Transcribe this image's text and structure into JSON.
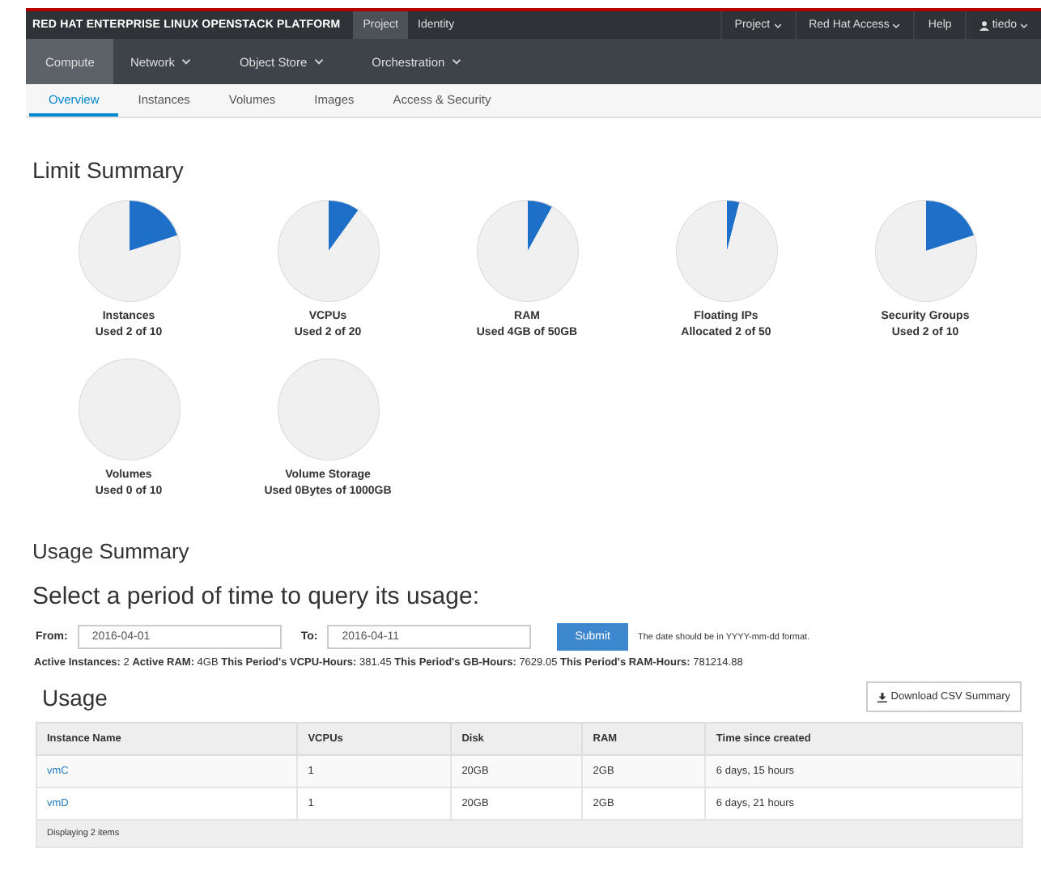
{
  "topbar": {
    "brand": "RED HAT",
    "product": "ENTERPRISE LINUX OPENSTACK PLATFORM",
    "tabs": [
      {
        "label": "Project",
        "selected": true
      },
      {
        "label": "Identity",
        "selected": false
      }
    ],
    "menus": [
      "Project",
      "Red Hat Access"
    ],
    "help": "Help",
    "user": "tiedo"
  },
  "nav": [
    {
      "label": "Compute",
      "selected": true,
      "dropdown": false
    },
    {
      "label": "Network",
      "selected": false,
      "dropdown": true
    },
    {
      "label": "Object Store",
      "selected": false,
      "dropdown": true
    },
    {
      "label": "Orchestration",
      "selected": false,
      "dropdown": true
    }
  ],
  "subtabs": [
    {
      "label": "Overview",
      "selected": true
    },
    {
      "label": "Instances",
      "selected": false
    },
    {
      "label": "Volumes",
      "selected": false
    },
    {
      "label": "Images",
      "selected": false
    },
    {
      "label": "Access & Security",
      "selected": false
    }
  ],
  "limit_summary": {
    "title": "Limit Summary",
    "items": [
      {
        "name": "Instances",
        "usage": "Used 2 of 10",
        "chart_data": {
          "type": "pie",
          "values": [
            20,
            80
          ]
        }
      },
      {
        "name": "VCPUs",
        "usage": "Used 2 of 20",
        "chart_data": {
          "type": "pie",
          "values": [
            10,
            90
          ]
        }
      },
      {
        "name": "RAM",
        "usage": "Used 4GB of 50GB",
        "chart_data": {
          "type": "pie",
          "values": [
            8,
            92
          ]
        }
      },
      {
        "name": "Floating IPs",
        "usage": "Allocated 2 of 50",
        "chart_data": {
          "type": "pie",
          "values": [
            4,
            96
          ]
        }
      },
      {
        "name": "Security Groups",
        "usage": "Used 2 of 10",
        "chart_data": {
          "type": "pie",
          "values": [
            20,
            80
          ]
        }
      },
      {
        "name": "Volumes",
        "usage": "Used 0 of 10",
        "chart_data": {
          "type": "pie",
          "values": [
            0,
            100
          ]
        }
      },
      {
        "name": "Volume Storage",
        "usage": "Used 0Bytes of 1000GB",
        "chart_data": {
          "type": "pie",
          "values": [
            0,
            100
          ]
        }
      }
    ]
  },
  "usage_summary": {
    "title": "Usage Summary",
    "subtitle": "Select a period of time to query its usage:",
    "from_label": "From:",
    "from_value": "2016-04-01",
    "to_label": "To:",
    "to_value": "2016-04-11",
    "submit": "Submit",
    "hint": "The date should be in YYYY-mm-dd format.",
    "stats": [
      {
        "label": "Active Instances:",
        "value": "2"
      },
      {
        "label": "Active RAM:",
        "value": "4GB"
      },
      {
        "label": "This Period's VCPU-Hours:",
        "value": "381.45"
      },
      {
        "label": "This Period's GB-Hours:",
        "value": "7629.05"
      },
      {
        "label": "This Period's RAM-Hours:",
        "value": "781214.88"
      }
    ]
  },
  "usage": {
    "title": "Usage",
    "download": "Download CSV Summary",
    "columns": [
      "Instance Name",
      "VCPUs",
      "Disk",
      "RAM",
      "Time since created"
    ],
    "rows": [
      [
        "vmC",
        "1",
        "20GB",
        "2GB",
        "6 days, 15 hours"
      ],
      [
        "vmD",
        "1",
        "20GB",
        "2GB",
        "6 days, 21 hours"
      ]
    ],
    "footer": "Displaying 2 items"
  }
}
